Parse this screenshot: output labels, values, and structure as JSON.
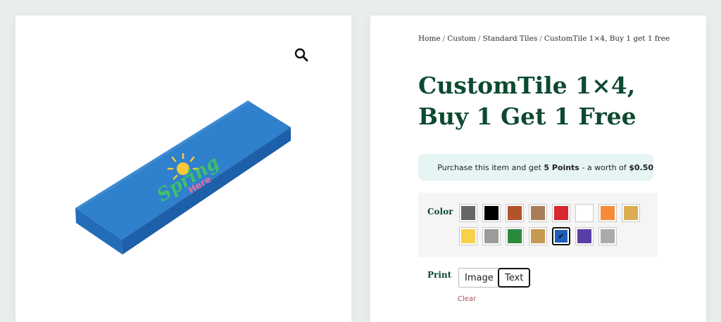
{
  "gallery": {
    "zoom_icon": "magnifier-icon",
    "image_alt": "Blue 1x4 custom tile printed with Spring Here artwork",
    "artwork_text": {
      "line1": "Spring",
      "line2": "Here"
    }
  },
  "breadcrumb": {
    "items": [
      "Home",
      "Custom",
      "Standard Tiles"
    ],
    "current": "CustomTile 1×4, Buy 1 get 1 free",
    "separator": "/"
  },
  "product": {
    "title_line1": "CustomTile 1×4,",
    "title_line2": "Buy 1 Get 1 Free"
  },
  "points": {
    "icon": "medal-icon",
    "prefix": "Purchase this item and get ",
    "points": "5 Points",
    "middle": " - a worth of ",
    "value": "$0.50"
  },
  "color": {
    "label": "Color",
    "swatches": [
      "#666666",
      "#000000",
      "#b3532b",
      "#a87e5a",
      "#d7282f",
      "#ffffff",
      "#f58b38",
      "#dcad52",
      "#f8d14a",
      "#9b9b9b",
      "#2b8a3e",
      "#c79850",
      "#1d5fb8",
      "#5a3ea8",
      "#aaaaaa"
    ],
    "selected_index": 12
  },
  "print": {
    "label": "Print",
    "options": [
      "Image",
      "Text"
    ],
    "selected": "Text",
    "clear_label": "Clear"
  },
  "colors": {
    "title": "#0c4a30",
    "tile_top": "#2e7fcc",
    "tile_side": "#1f63ab",
    "points_bg": "#e6f5f3",
    "clear": "#b5464e"
  }
}
